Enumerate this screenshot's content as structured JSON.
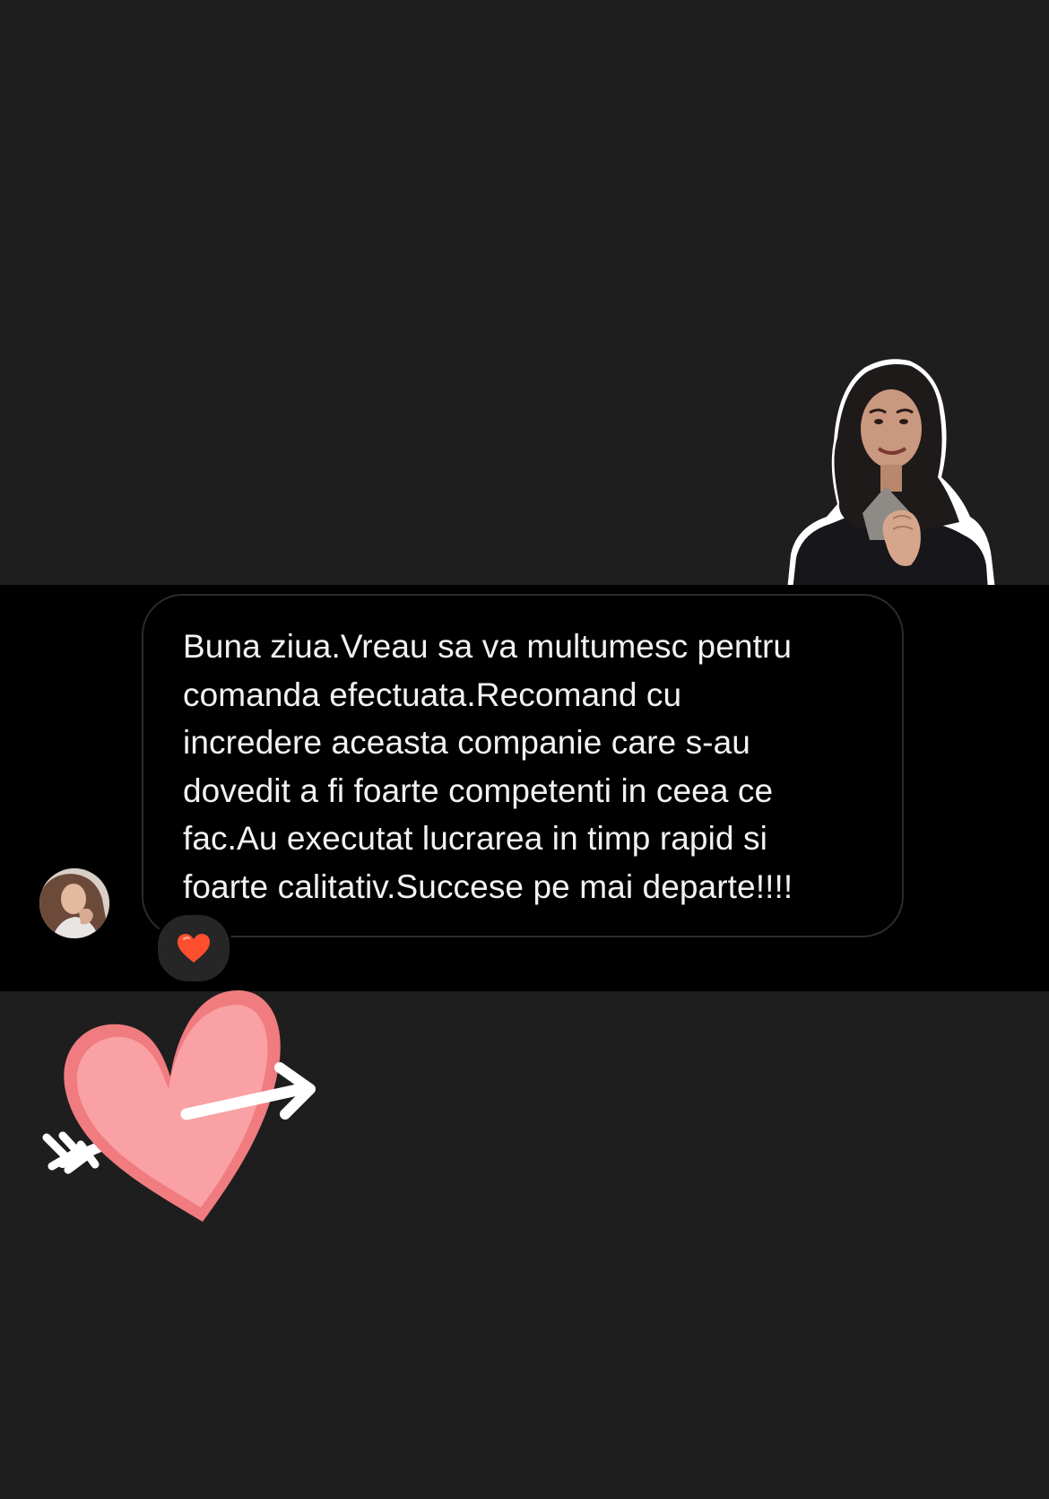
{
  "message": {
    "text_lines": [
      "Buna ziua.Vreau sa va multumesc pentru",
      "comanda efectuata.Recomand cu",
      "incredere aceasta companie care s-au",
      "dovedit a fi foarte competenti in ceea ce",
      "fac.Au executat lucrarea in timp rapid si",
      "foarte calitativ.Succese pe mai departe!!!!"
    ]
  },
  "reaction": {
    "emoji": "❤️"
  },
  "stickers": {
    "top": "woman-gif-sticker",
    "bottom": "heart-arrow-sticker"
  },
  "colors": {
    "background": "#1e1e1f",
    "chat_strip": "#000000",
    "bubble_border": "#2b2b2b",
    "text": "#f2f2f2",
    "heart_fill": "#f58b8f"
  }
}
